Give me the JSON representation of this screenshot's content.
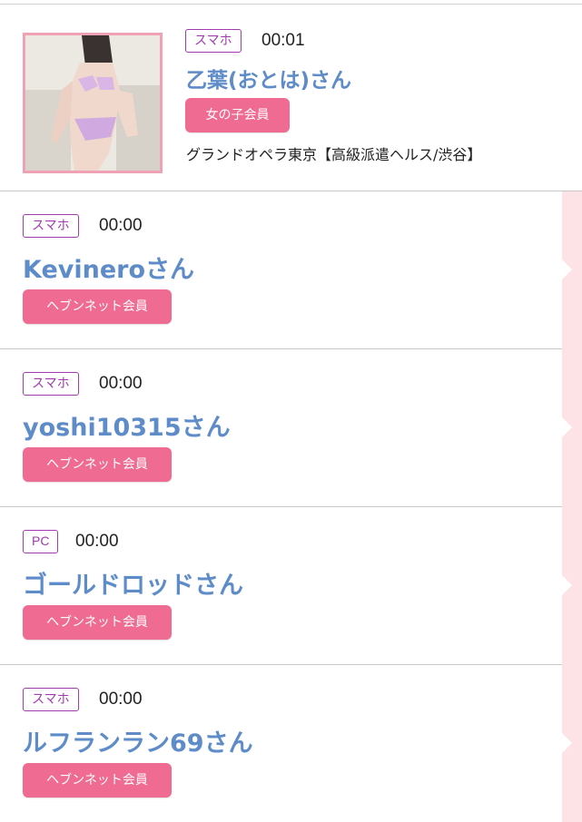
{
  "entries": [
    {
      "device": "スマホ",
      "time": "00:01",
      "name": "乙葉(おとは)さん",
      "badge": "女の子会員",
      "shop": "グランドオペラ東京【高級派遣ヘルス/渋谷】"
    },
    {
      "device": "スマホ",
      "time": "00:00",
      "name": "Kevineroさん",
      "badge": "ヘブンネット会員"
    },
    {
      "device": "スマホ",
      "time": "00:00",
      "name": "yoshi10315さん",
      "badge": "ヘブンネット会員"
    },
    {
      "device": "PC",
      "time": "00:00",
      "name": "ゴールドロッドさん",
      "badge": "ヘブンネット会員"
    },
    {
      "device": "スマホ",
      "time": "00:00",
      "name": "ルフランラン69さん",
      "badge": "ヘブンネット会員"
    }
  ],
  "colors": {
    "device_border": "#a23bb0",
    "name": "#5e8cc9",
    "badge_bg": "#f06b92",
    "thumb_border": "#f0a2b4",
    "side_strip": "#fde3e6"
  }
}
